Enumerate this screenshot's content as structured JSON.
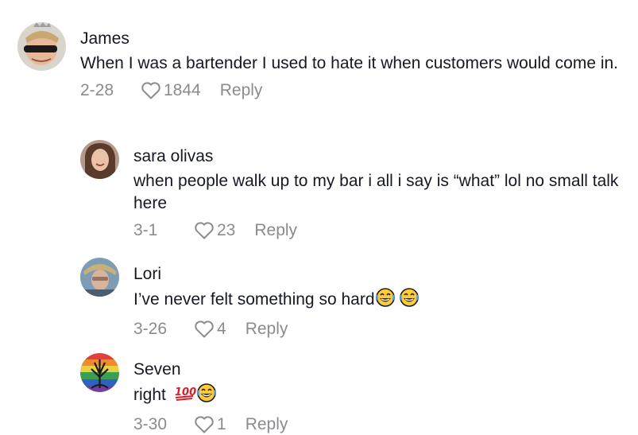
{
  "comments": [
    {
      "username": "James",
      "text": "When I was a bartender I used to hate it when customers would come in.",
      "date": "2-28",
      "likes": "1844",
      "reply_label": "Reply"
    },
    {
      "username": "sara olivas",
      "text": "when people walk up to my bar i all i say is “what” lol no small talk here",
      "date": "3-1",
      "likes": "23",
      "reply_label": "Reply"
    },
    {
      "username": "Lori",
      "text": "I’ve never felt something so hard",
      "date": "3-26",
      "likes": "4",
      "reply_label": "Reply"
    },
    {
      "username": "Seven",
      "text": "right",
      "date": "3-30",
      "likes": "1",
      "reply_label": "Reply"
    }
  ],
  "icons": {
    "like": "heart-outline-icon",
    "laugh": "face-with-tears-of-joy-emoji",
    "hundred": "hundred-points-emoji"
  },
  "colors": {
    "text": "#161823",
    "meta": "#8a8b91"
  }
}
